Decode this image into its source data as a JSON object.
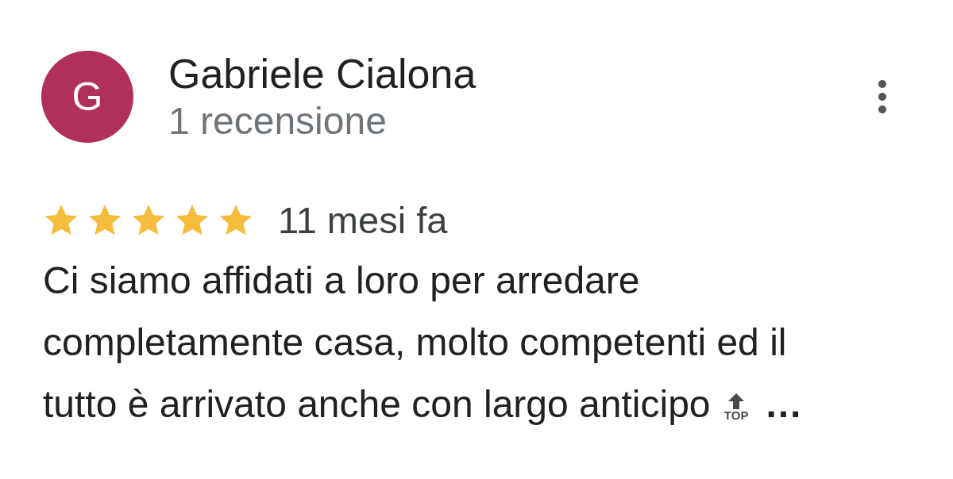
{
  "review": {
    "author": {
      "initial": "G",
      "name": "Gabriele Cialona",
      "color": "#b02f5c",
      "meta": "1 recensione"
    },
    "stars": 5,
    "time": "11 mesi fa",
    "text": "Ci siamo affidati a loro per arredare completamente casa, molto competenti ed il tutto è arrivato anche con largo anticipo",
    "emoji": {
      "label": "TOP"
    },
    "more": "…"
  }
}
